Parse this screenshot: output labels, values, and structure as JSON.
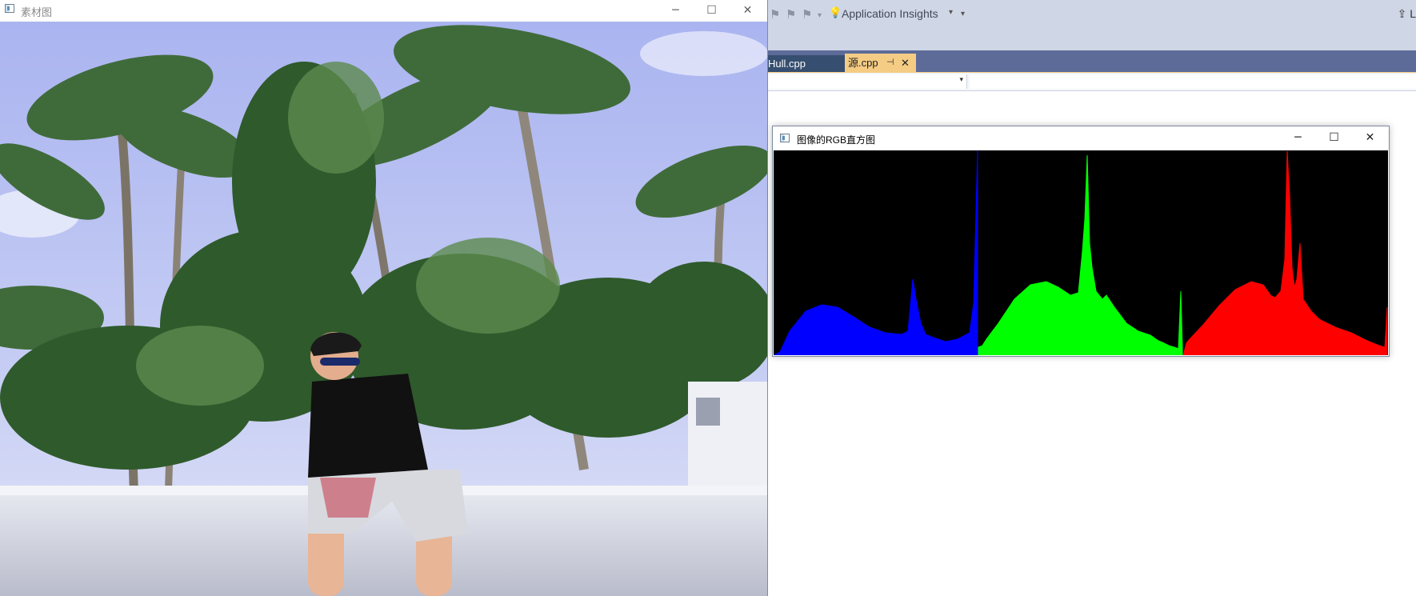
{
  "image_window": {
    "title": "素材图",
    "controls": {
      "minimize": "─",
      "maximize": "☐",
      "close": "✕"
    }
  },
  "vs": {
    "toolbar": {
      "icons": [
        "bookmark-icon",
        "bookmark-prev-icon",
        "bookmark-next-icon"
      ],
      "insights_label": "Application Insights",
      "insights_arrow": "▾",
      "overflow": "▾",
      "share_label": "⇪ L"
    },
    "tabs": [
      {
        "label": "Hull.cpp",
        "active": false
      },
      {
        "label": "源.cpp",
        "active": true,
        "pin": "⊣",
        "close": "✕"
      }
    ],
    "navbar": {
      "dropdown_arrow": "▾"
    },
    "colors": {
      "toolbar": "#cfd6e5",
      "tabstrip": "#5d6b99",
      "active_tab": "#f5cc84",
      "inactive_tab": "#364e6f"
    }
  },
  "histogram_window": {
    "title": "图像的RGB直方图",
    "controls": {
      "minimize": "─",
      "maximize": "☐",
      "close": "✕"
    },
    "colors": {
      "blue": "#0000ff",
      "green": "#00ff00",
      "red": "#ff0000",
      "background": "#000000"
    }
  },
  "chart_data": {
    "type": "area",
    "title": "",
    "xlabel": "",
    "ylabel": "",
    "ylim": [
      0,
      256
    ],
    "series": [
      {
        "color": "#0000ff",
        "bins": [
          0,
          8,
          20,
          40,
          60,
          80,
          100,
          120,
          140,
          160,
          168,
          174,
          178,
          184,
          190,
          200,
          215,
          230,
          245,
          250,
          255
        ],
        "values": [
          0,
          4,
          30,
          55,
          63,
          60,
          48,
          35,
          28,
          26,
          30,
          95,
          70,
          40,
          26,
          22,
          17,
          20,
          28,
          65,
          256
        ]
      },
      {
        "color": "#00ff00",
        "bins": [
          0,
          5,
          10,
          25,
          45,
          65,
          85,
          100,
          115,
          125,
          130,
          133,
          136,
          139,
          142,
          147,
          155,
          160,
          170,
          185,
          200,
          215,
          225,
          230,
          238,
          245,
          250,
          253,
          255
        ],
        "values": [
          10,
          12,
          20,
          40,
          70,
          88,
          92,
          85,
          75,
          78,
          130,
          170,
          250,
          140,
          110,
          80,
          70,
          75,
          60,
          40,
          30,
          25,
          18,
          16,
          12,
          10,
          8,
          80,
          10
        ]
      },
      {
        "color": "#ff0000",
        "bins": [
          0,
          4,
          8,
          25,
          45,
          65,
          85,
          100,
          110,
          115,
          122,
          127,
          130,
          133,
          136,
          139,
          142,
          146,
          150,
          160,
          170,
          190,
          210,
          230,
          245,
          252,
          255
        ],
        "values": [
          0,
          15,
          20,
          38,
          62,
          82,
          92,
          88,
          74,
          72,
          80,
          120,
          255,
          200,
          110,
          85,
          95,
          140,
          70,
          55,
          45,
          35,
          28,
          18,
          12,
          10,
          60
        ]
      }
    ]
  }
}
